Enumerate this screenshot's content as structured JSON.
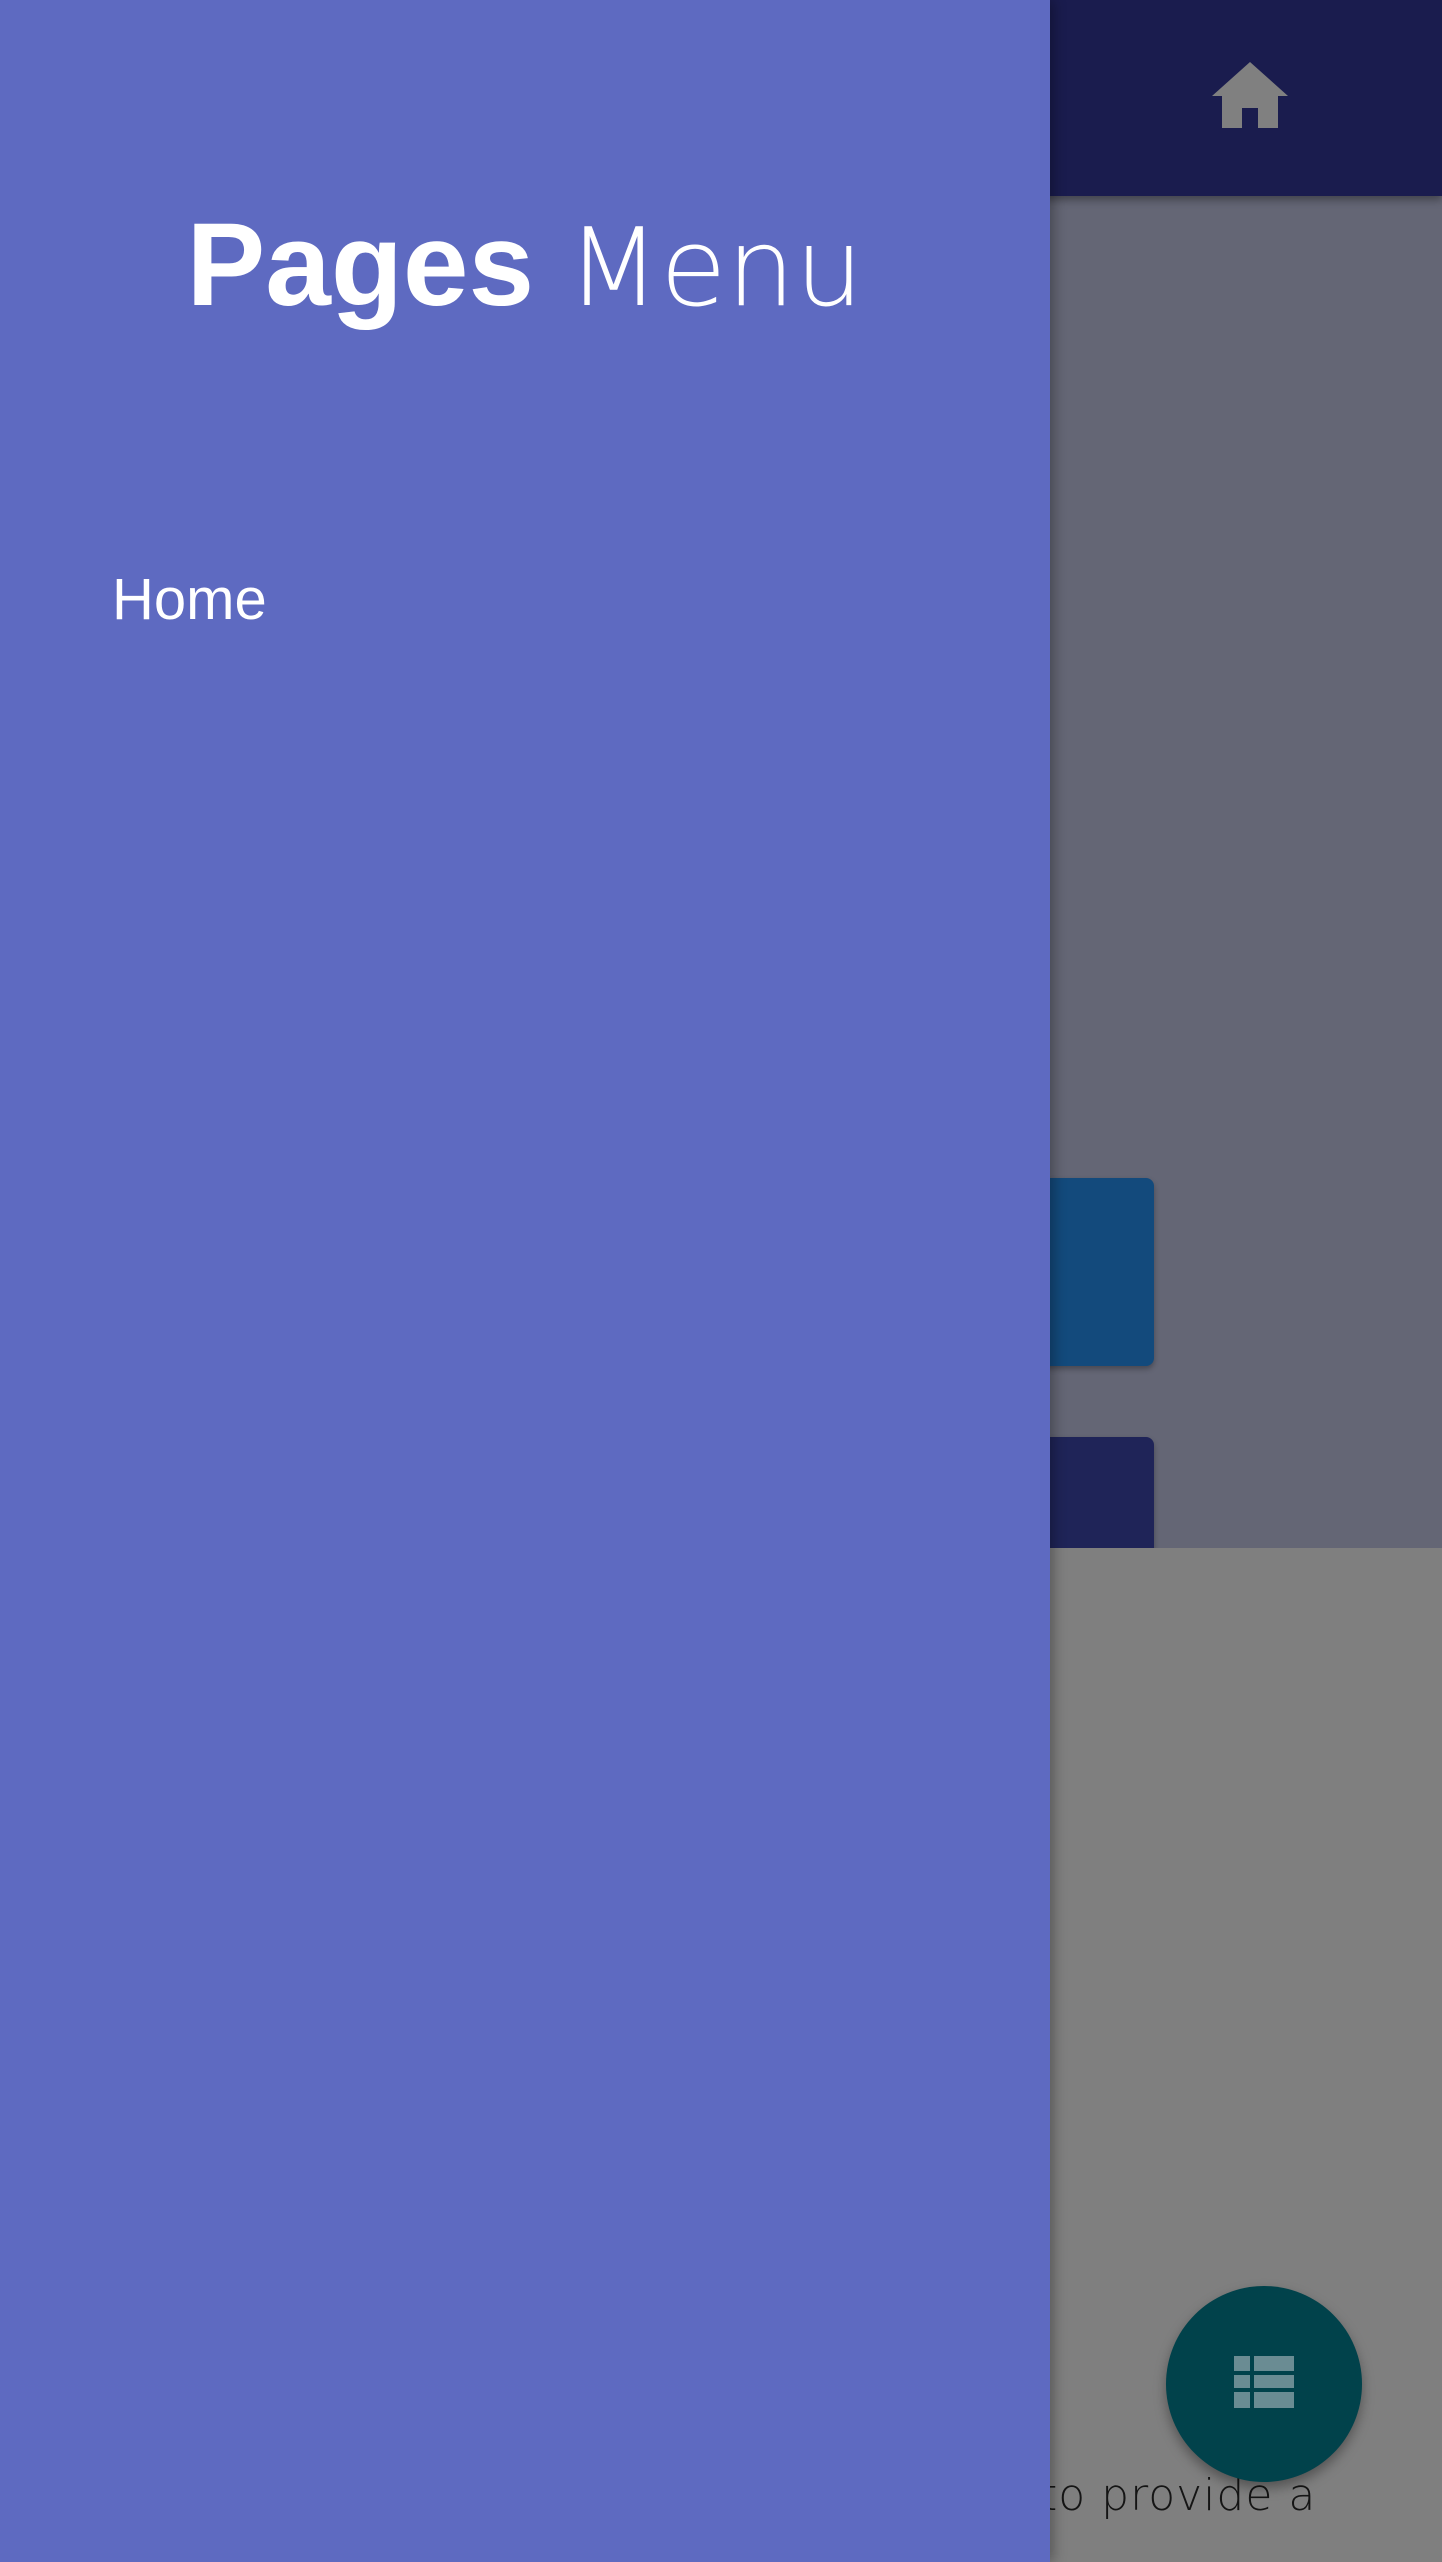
{
  "drawer": {
    "title_bold": "Pages",
    "title_light": "Menu",
    "items": [
      {
        "label": "Home"
      }
    ]
  },
  "appbar": {
    "icon": "home-icon"
  },
  "content": {
    "text_visible": "to provide a"
  },
  "fab": {
    "icon": "list-icon"
  },
  "colors": {
    "drawer": "#5e6ac1",
    "appbar": "#1a1c4e",
    "fab": "#01424b",
    "scrim_hero": "#646675",
    "scrim_content": "#7f7f7f"
  }
}
